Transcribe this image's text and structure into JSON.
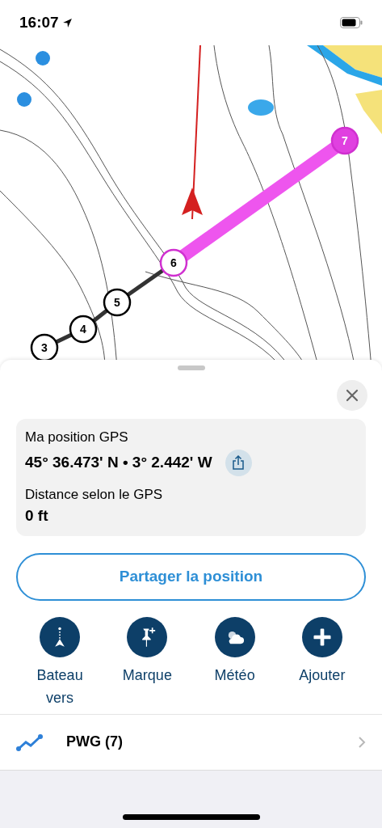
{
  "status_bar": {
    "time": "16:07"
  },
  "map": {
    "waypoints": [
      {
        "label": "3",
        "active": false
      },
      {
        "label": "4",
        "active": false
      },
      {
        "label": "5",
        "active": false
      },
      {
        "label": "6",
        "active": true
      },
      {
        "label": "7",
        "active": true
      }
    ]
  },
  "sheet": {
    "position_label": "Ma position GPS",
    "position_value": "45° 36.473' N • 3° 2.442' W",
    "distance_label": "Distance selon le GPS",
    "distance_value": "0 ft",
    "share_button": "Partager la position",
    "actions": [
      {
        "kind": "boat",
        "label": "Bateau vers"
      },
      {
        "kind": "mark",
        "label": "Marque"
      },
      {
        "kind": "weather",
        "label": "Météo"
      },
      {
        "kind": "add",
        "label": "Ajouter"
      }
    ],
    "route": {
      "name": "PWG (7)"
    }
  }
}
